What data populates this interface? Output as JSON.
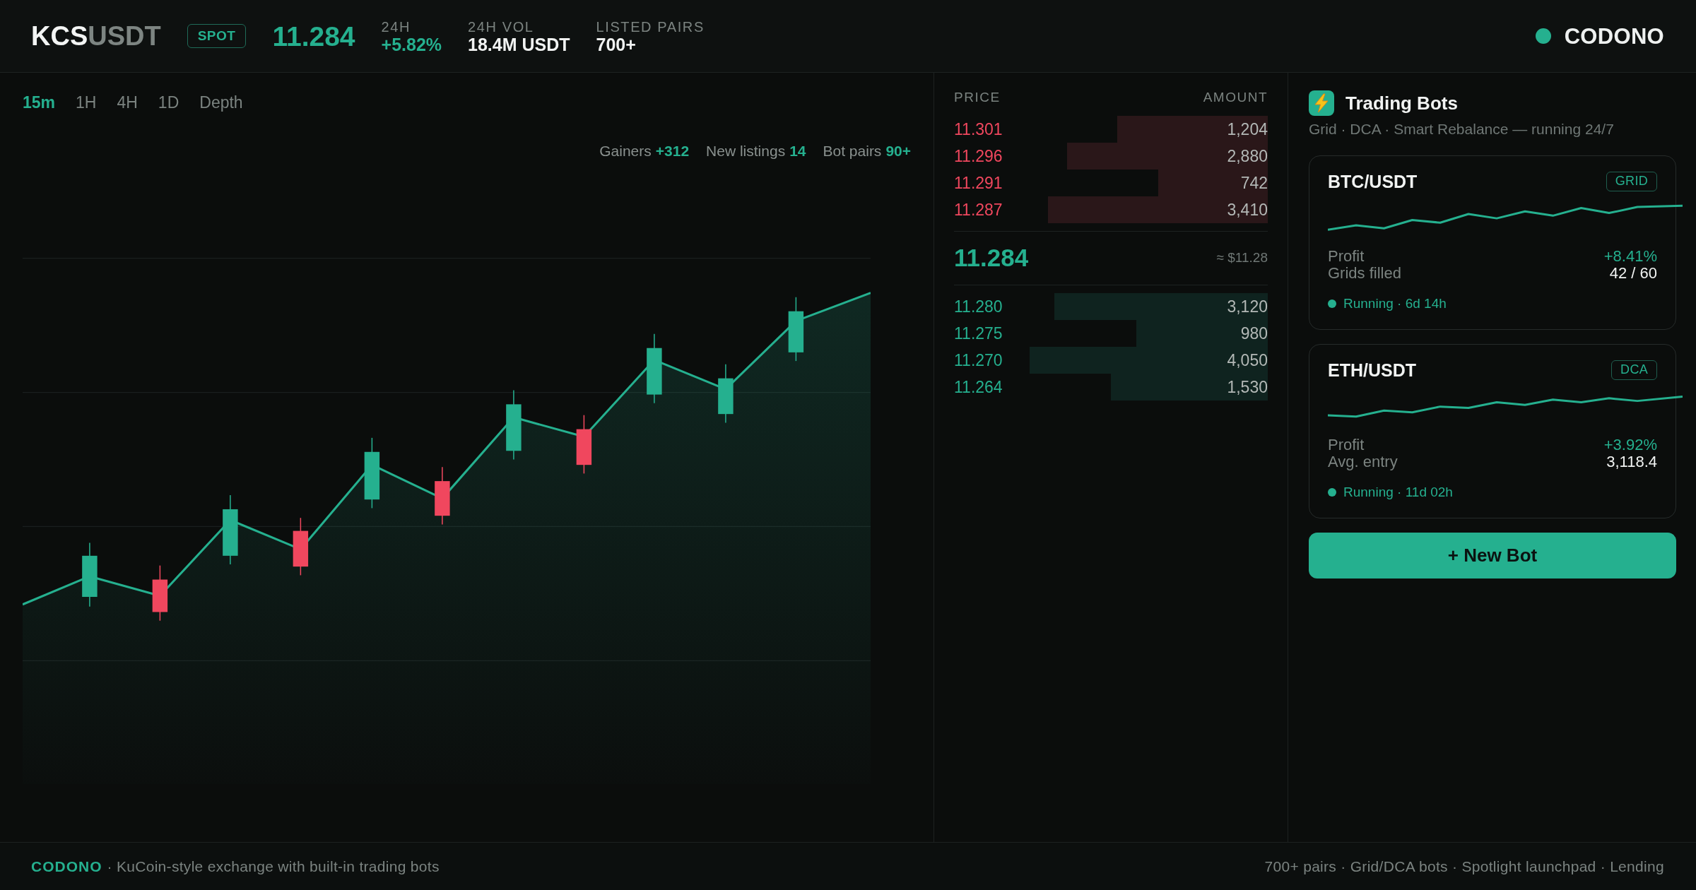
{
  "header": {
    "pair": {
      "base": "KCS",
      "quote": "USDT"
    },
    "market_badge": "SPOT",
    "last_price": "11.284",
    "stats": [
      {
        "label": "24H",
        "value": "+5.82%",
        "kind": "up"
      },
      {
        "label": "24H VOL",
        "value": "18.4M USDT",
        "kind": "plain"
      },
      {
        "label": "LISTED PAIRS",
        "value": "700+",
        "kind": "plain"
      }
    ],
    "brand": "CODONO"
  },
  "chart": {
    "timeframes": [
      {
        "label": "15m",
        "selected": true
      },
      {
        "label": "1H",
        "selected": false
      },
      {
        "label": "4H",
        "selected": false
      },
      {
        "label": "1D",
        "selected": false
      },
      {
        "label": "Depth",
        "selected": false
      }
    ],
    "highlights": [
      {
        "label": "Gainers",
        "value": "+312"
      },
      {
        "label": "New listings",
        "value": "14"
      },
      {
        "label": "Bot pairs",
        "value": "90+"
      }
    ]
  },
  "order_book": {
    "columns": [
      "PRICE",
      "AMOUNT"
    ],
    "asks": [
      {
        "price": "11.301",
        "amount": "1,204",
        "level": 0.48
      },
      {
        "price": "11.296",
        "amount": "2,880",
        "level": 0.64
      },
      {
        "price": "11.291",
        "amount": "742",
        "level": 0.35
      },
      {
        "price": "11.287",
        "amount": "3,410",
        "level": 0.7
      }
    ],
    "last_price": "11.284",
    "fiat_price": "≈ $11.28",
    "bids": [
      {
        "price": "11.280",
        "amount": "3,120",
        "level": 0.68
      },
      {
        "price": "11.275",
        "amount": "980",
        "level": 0.42
      },
      {
        "price": "11.270",
        "amount": "4,050",
        "level": 0.76
      },
      {
        "price": "11.264",
        "amount": "1,530",
        "level": 0.5
      }
    ]
  },
  "bots": {
    "title": "Trading Bots",
    "subtitle": "Grid · DCA · Smart Rebalance — running 24/7",
    "cards": [
      {
        "pair": "BTC/USDT",
        "strategy": "GRID",
        "metrics": [
          {
            "label": "Profit",
            "value": "+8.41%",
            "kind": "gain"
          },
          {
            "label": "Grids filled",
            "value": "42 / 60",
            "kind": "plain"
          }
        ],
        "status": "Running · 6d 14h"
      },
      {
        "pair": "ETH/USDT",
        "strategy": "DCA",
        "metrics": [
          {
            "label": "Profit",
            "value": "+3.92%",
            "kind": "gain"
          },
          {
            "label": "Avg. entry",
            "value": "3,118.4",
            "kind": "plain"
          }
        ],
        "status": "Running · 11d 02h"
      }
    ],
    "new_bot_button": "+ New Bot"
  },
  "footer": {
    "brand": "CODONO",
    "tagline": "· KuCoin-style exchange with built-in trading bots",
    "features": "700+ pairs · Grid/DCA bots · Spotlight launchpad · Lending"
  }
}
